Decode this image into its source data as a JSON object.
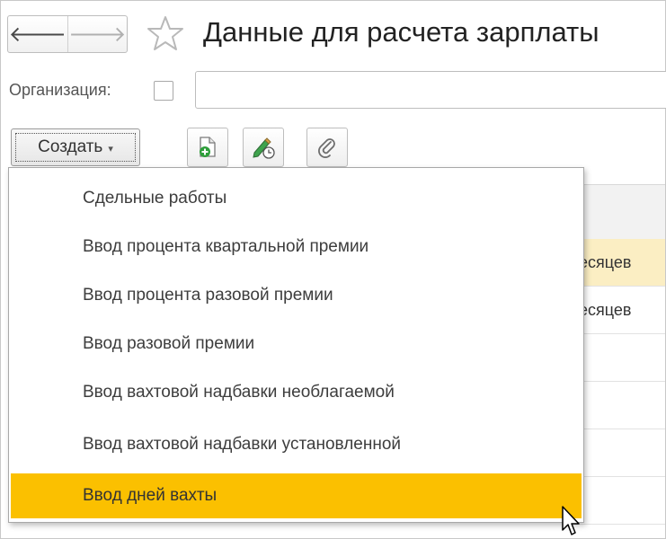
{
  "header": {
    "back_icon": "arrow-left-icon",
    "forward_icon": "arrow-right-icon",
    "favorite_icon": "star-outline-icon",
    "title": "Данные для расчета зарплаты"
  },
  "filter": {
    "organization_label": "Организация:",
    "organization_checked": false,
    "organization_value": ""
  },
  "toolbar": {
    "create_label": "Создать",
    "create_caret": "▾",
    "buttons": [
      {
        "name": "copy",
        "icon": "document-add-icon"
      },
      {
        "name": "edit",
        "icon": "pencil-clock-icon"
      },
      {
        "name": "attach",
        "icon": "paperclip-icon"
      }
    ]
  },
  "table": {
    "visible_rows": [
      {
        "text": "есяцев",
        "selected": true
      },
      {
        "text": "есяцев",
        "selected": false
      },
      {
        "text": "",
        "selected": false
      },
      {
        "text": "",
        "selected": false
      },
      {
        "text": "",
        "selected": false
      },
      {
        "text": "",
        "selected": false
      }
    ]
  },
  "create_menu": {
    "items": [
      {
        "label": "Сдельные работы",
        "highlighted": false
      },
      {
        "label": "Ввод процента квартальной премии",
        "highlighted": false
      },
      {
        "label": "Ввод процента разовой премии",
        "highlighted": false
      },
      {
        "label": "Ввод разовой премии",
        "highlighted": false
      },
      {
        "label": "Ввод вахтовой надбавки необлагаемой",
        "highlighted": false
      },
      {
        "label": "Ввод вахтовой надбавки установленной",
        "highlighted": false
      },
      {
        "label": "Ввод дней вахты",
        "highlighted": true
      }
    ]
  },
  "colors": {
    "highlight": "#fbc000",
    "selected_row": "#fbeec3"
  }
}
